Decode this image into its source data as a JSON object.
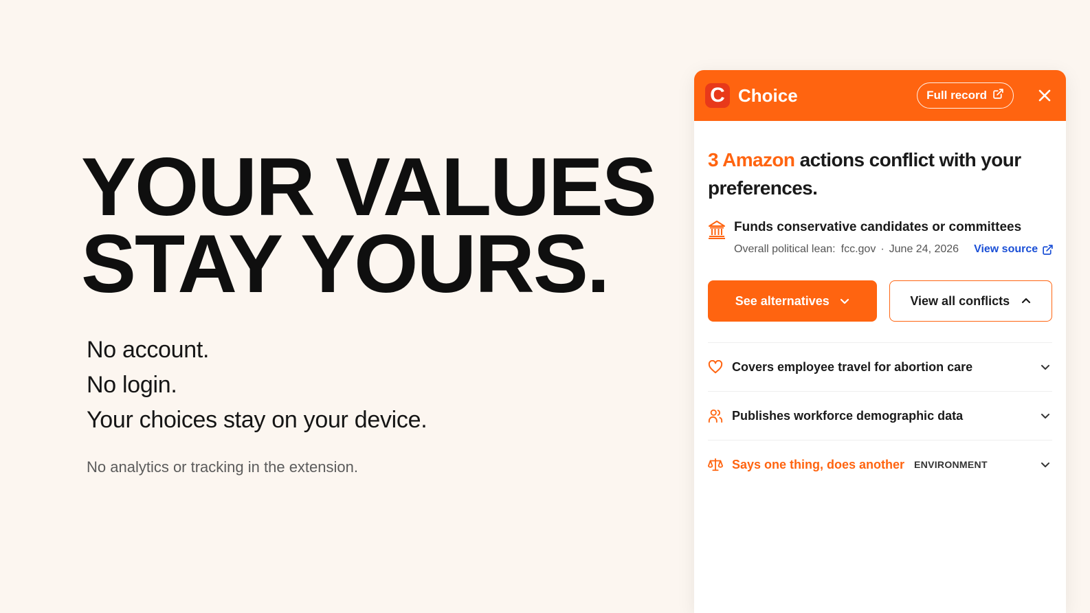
{
  "hero": {
    "headline_line1": "YOUR VALUES",
    "headline_line2": "STAY YOURS.",
    "claims": [
      "No account.",
      "No login.",
      "Your choices stay on your device."
    ],
    "footnote": "No analytics or tracking in the extension."
  },
  "panel": {
    "logo_letter": "C",
    "brand": "Choice",
    "full_record_label": "Full record",
    "summary": {
      "count_company": "3 Amazon",
      "rest": " actions conflict with your preferences."
    },
    "finding": {
      "title": "Funds conservative candidates or committees",
      "meta_label": "Overall political lean:",
      "source_domain": "fcc.gov",
      "separator": "·",
      "date": "June 24, 2026",
      "view_source_label": "View source"
    },
    "buttons": {
      "alternatives": "See alternatives",
      "all_conflicts": "View all conflicts"
    },
    "conflicts": [
      {
        "label": "Covers employee travel for abortion care",
        "icon": "heart-icon"
      },
      {
        "label": "Publishes workforce demographic data",
        "icon": "people-icon"
      },
      {
        "label": "Says one thing, does another",
        "tag": "ENVIRONMENT",
        "icon": "scale-icon"
      }
    ],
    "colors": {
      "accent": "#ff6410",
      "link": "#1a4fd6",
      "background": "#fcf6f0"
    }
  }
}
